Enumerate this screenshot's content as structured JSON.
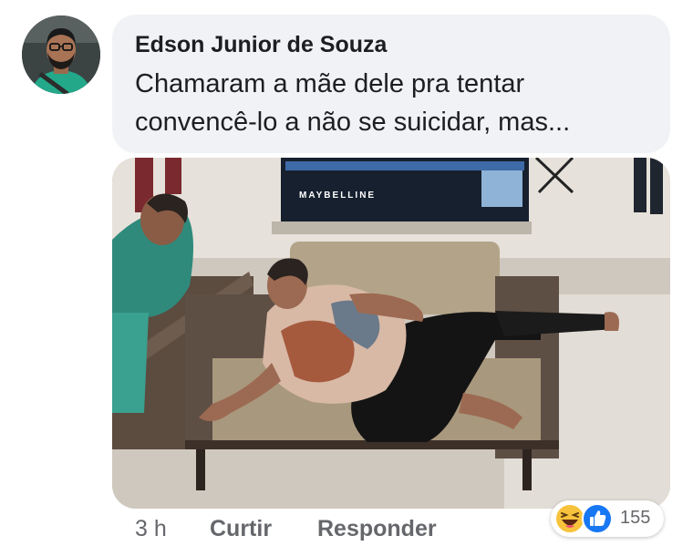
{
  "comment": {
    "author": "Edson Junior de Souza",
    "text_line1": "Chamaram a mãe dele pra tentar",
    "text_line2": "convencê-lo a não se suicidar, mas..."
  },
  "photo": {
    "sign_text": "MAYBELLINE"
  },
  "actions": {
    "time": "3 h",
    "like_label": "Curtir",
    "reply_label": "Responder"
  },
  "reactions": {
    "icons": [
      "haha-icon",
      "like-icon"
    ],
    "count": "155"
  },
  "colors": {
    "bubble_bg": "#f0f2f5",
    "text": "#1c1e21",
    "secondary": "#65676b",
    "like_blue": "#1877f2",
    "haha_yellow": "#f7c33d"
  }
}
